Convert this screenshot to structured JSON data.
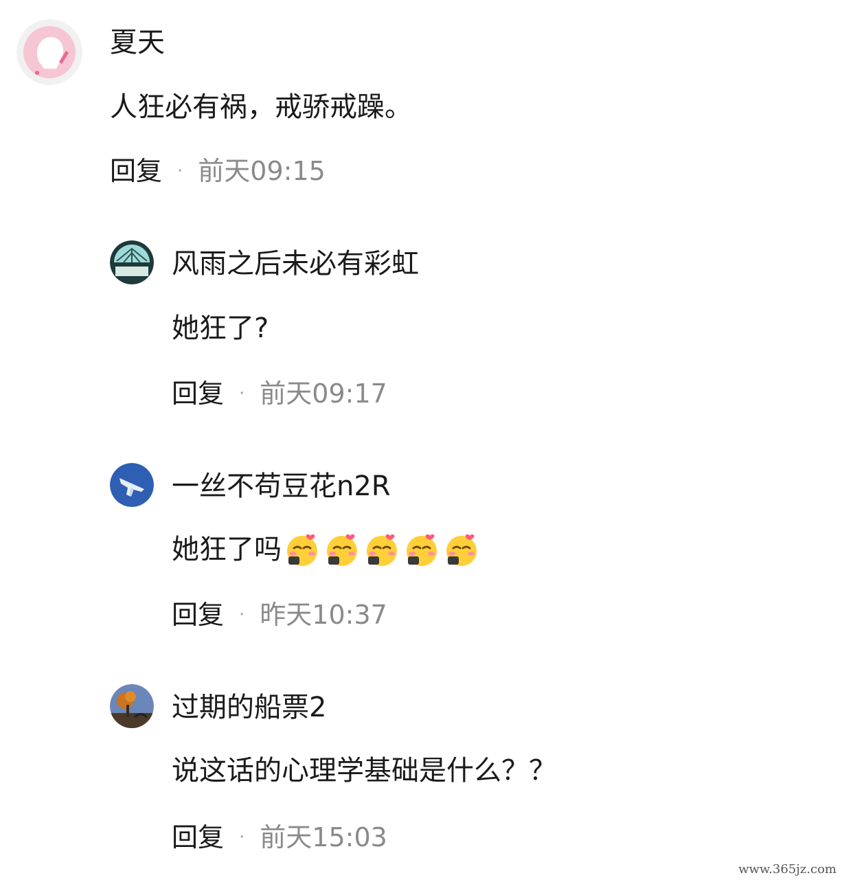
{
  "comments": [
    {
      "username": "夏天",
      "text": "人狂必有祸，戒骄戒躁。",
      "reply_label": "回复",
      "separator": "·",
      "time": "前天09:15",
      "avatar_icon": "pink-silhouette-avatar"
    },
    {
      "username": "风雨之后未必有彩虹",
      "text": "她狂了?",
      "reply_label": "回复",
      "separator": "·",
      "time": "前天09:17",
      "avatar_icon": "glass-dome-avatar"
    },
    {
      "username": "一丝不苟豆花n2R",
      "text": "她狂了吗",
      "emoji_name": "blushing-smile-emoji",
      "emoji_count": 5,
      "reply_label": "回复",
      "separator": "·",
      "time": "昨天10:37",
      "avatar_icon": "jet-plane-avatar"
    },
    {
      "username": "过期的船票2",
      "text": "说这话的心理学基础是什么？？",
      "reply_label": "回复",
      "separator": "·",
      "time": "前天15:03",
      "avatar_icon": "autumn-tree-avatar"
    }
  ],
  "watermark": "www.365jz.com",
  "colors": {
    "text": "#1a1a1a",
    "time": "#8a8a8a",
    "background": "#ffffff"
  }
}
